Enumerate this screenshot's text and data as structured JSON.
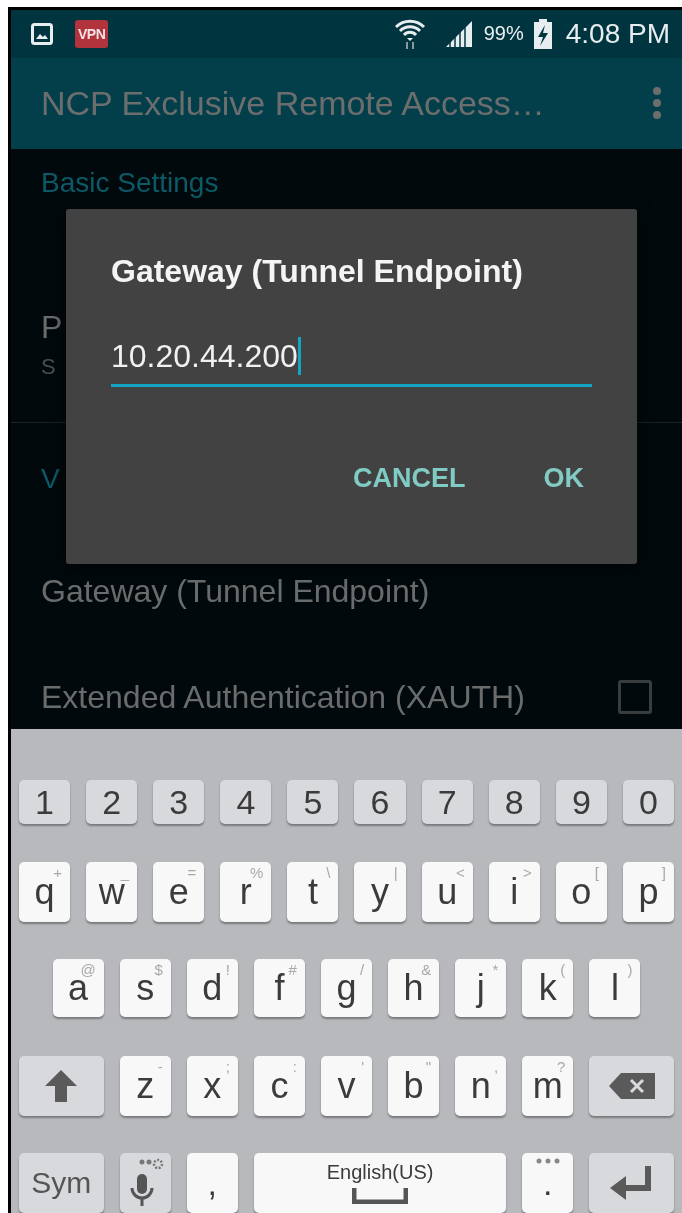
{
  "status_bar": {
    "vpn_badge": "VPN",
    "battery": "99%",
    "time": "4:08 PM"
  },
  "app_bar": {
    "title": "NCP Exclusive Remote Access…"
  },
  "settings": [
    {
      "kind": "header",
      "text": "Basic Settings"
    },
    {
      "kind": "item",
      "title": "P",
      "subtitle": "S"
    },
    {
      "kind": "header",
      "text": "V"
    },
    {
      "kind": "item",
      "title": "Gateway (Tunnel Endpoint)"
    },
    {
      "kind": "checkbox",
      "title": "Extended Authentication (XAUTH)",
      "checked": false
    }
  ],
  "dialog": {
    "title": "Gateway (Tunnel Endpoint)",
    "value": "10.20.44.200",
    "buttons": [
      "CANCEL",
      "OK"
    ]
  },
  "keyboard": {
    "rows": [
      {
        "keys": [
          {
            "kind": "digit",
            "label": "1"
          },
          {
            "kind": "digit",
            "label": "2"
          },
          {
            "kind": "digit",
            "label": "3"
          },
          {
            "kind": "digit",
            "label": "4"
          },
          {
            "kind": "digit",
            "label": "5"
          },
          {
            "kind": "digit",
            "label": "6"
          },
          {
            "kind": "digit",
            "label": "7"
          },
          {
            "kind": "digit",
            "label": "8"
          },
          {
            "kind": "digit",
            "label": "9"
          },
          {
            "kind": "digit",
            "label": "0"
          }
        ]
      },
      {
        "keys": [
          {
            "kind": "letter",
            "label": "q",
            "hint": "+"
          },
          {
            "kind": "letter",
            "label": "w",
            "hint": "_"
          },
          {
            "kind": "letter",
            "label": "e",
            "hint": "="
          },
          {
            "kind": "letter",
            "label": "r",
            "hint": "%"
          },
          {
            "kind": "letter",
            "label": "t",
            "hint": "\\"
          },
          {
            "kind": "letter",
            "label": "y",
            "hint": "|"
          },
          {
            "kind": "letter",
            "label": "u",
            "hint": "<"
          },
          {
            "kind": "letter",
            "label": "i",
            "hint": ">"
          },
          {
            "kind": "letter",
            "label": "o",
            "hint": "["
          },
          {
            "kind": "letter",
            "label": "p",
            "hint": "]"
          }
        ]
      },
      {
        "keys": [
          {
            "kind": "letter",
            "label": "a",
            "hint": "@"
          },
          {
            "kind": "letter",
            "label": "s",
            "hint": "$"
          },
          {
            "kind": "letter",
            "label": "d",
            "hint": "!"
          },
          {
            "kind": "letter",
            "label": "f",
            "hint": "#"
          },
          {
            "kind": "letter",
            "label": "g",
            "hint": "/"
          },
          {
            "kind": "letter",
            "label": "h",
            "hint": "&"
          },
          {
            "kind": "letter",
            "label": "j",
            "hint": "*"
          },
          {
            "kind": "letter",
            "label": "k",
            "hint": "("
          },
          {
            "kind": "letter",
            "label": "l",
            "hint": ")"
          }
        ]
      },
      {
        "keys": [
          {
            "kind": "shift"
          },
          {
            "kind": "letter",
            "label": "z",
            "hint": "-"
          },
          {
            "kind": "letter",
            "label": "x",
            "hint": ";"
          },
          {
            "kind": "letter",
            "label": "c",
            "hint": ":"
          },
          {
            "kind": "letter",
            "label": "v",
            "hint": "'"
          },
          {
            "kind": "letter",
            "label": "b",
            "hint": "\""
          },
          {
            "kind": "letter",
            "label": "n",
            "hint": ","
          },
          {
            "kind": "letter",
            "label": "m",
            "hint": "?"
          },
          {
            "kind": "backspace"
          }
        ]
      },
      {
        "keys": [
          {
            "kind": "sym",
            "label": "Sym"
          },
          {
            "kind": "mic"
          },
          {
            "kind": "comma",
            "label": ","
          },
          {
            "kind": "space",
            "label": "English(US)"
          },
          {
            "kind": "period",
            "label": "."
          },
          {
            "kind": "enter"
          }
        ]
      }
    ]
  }
}
